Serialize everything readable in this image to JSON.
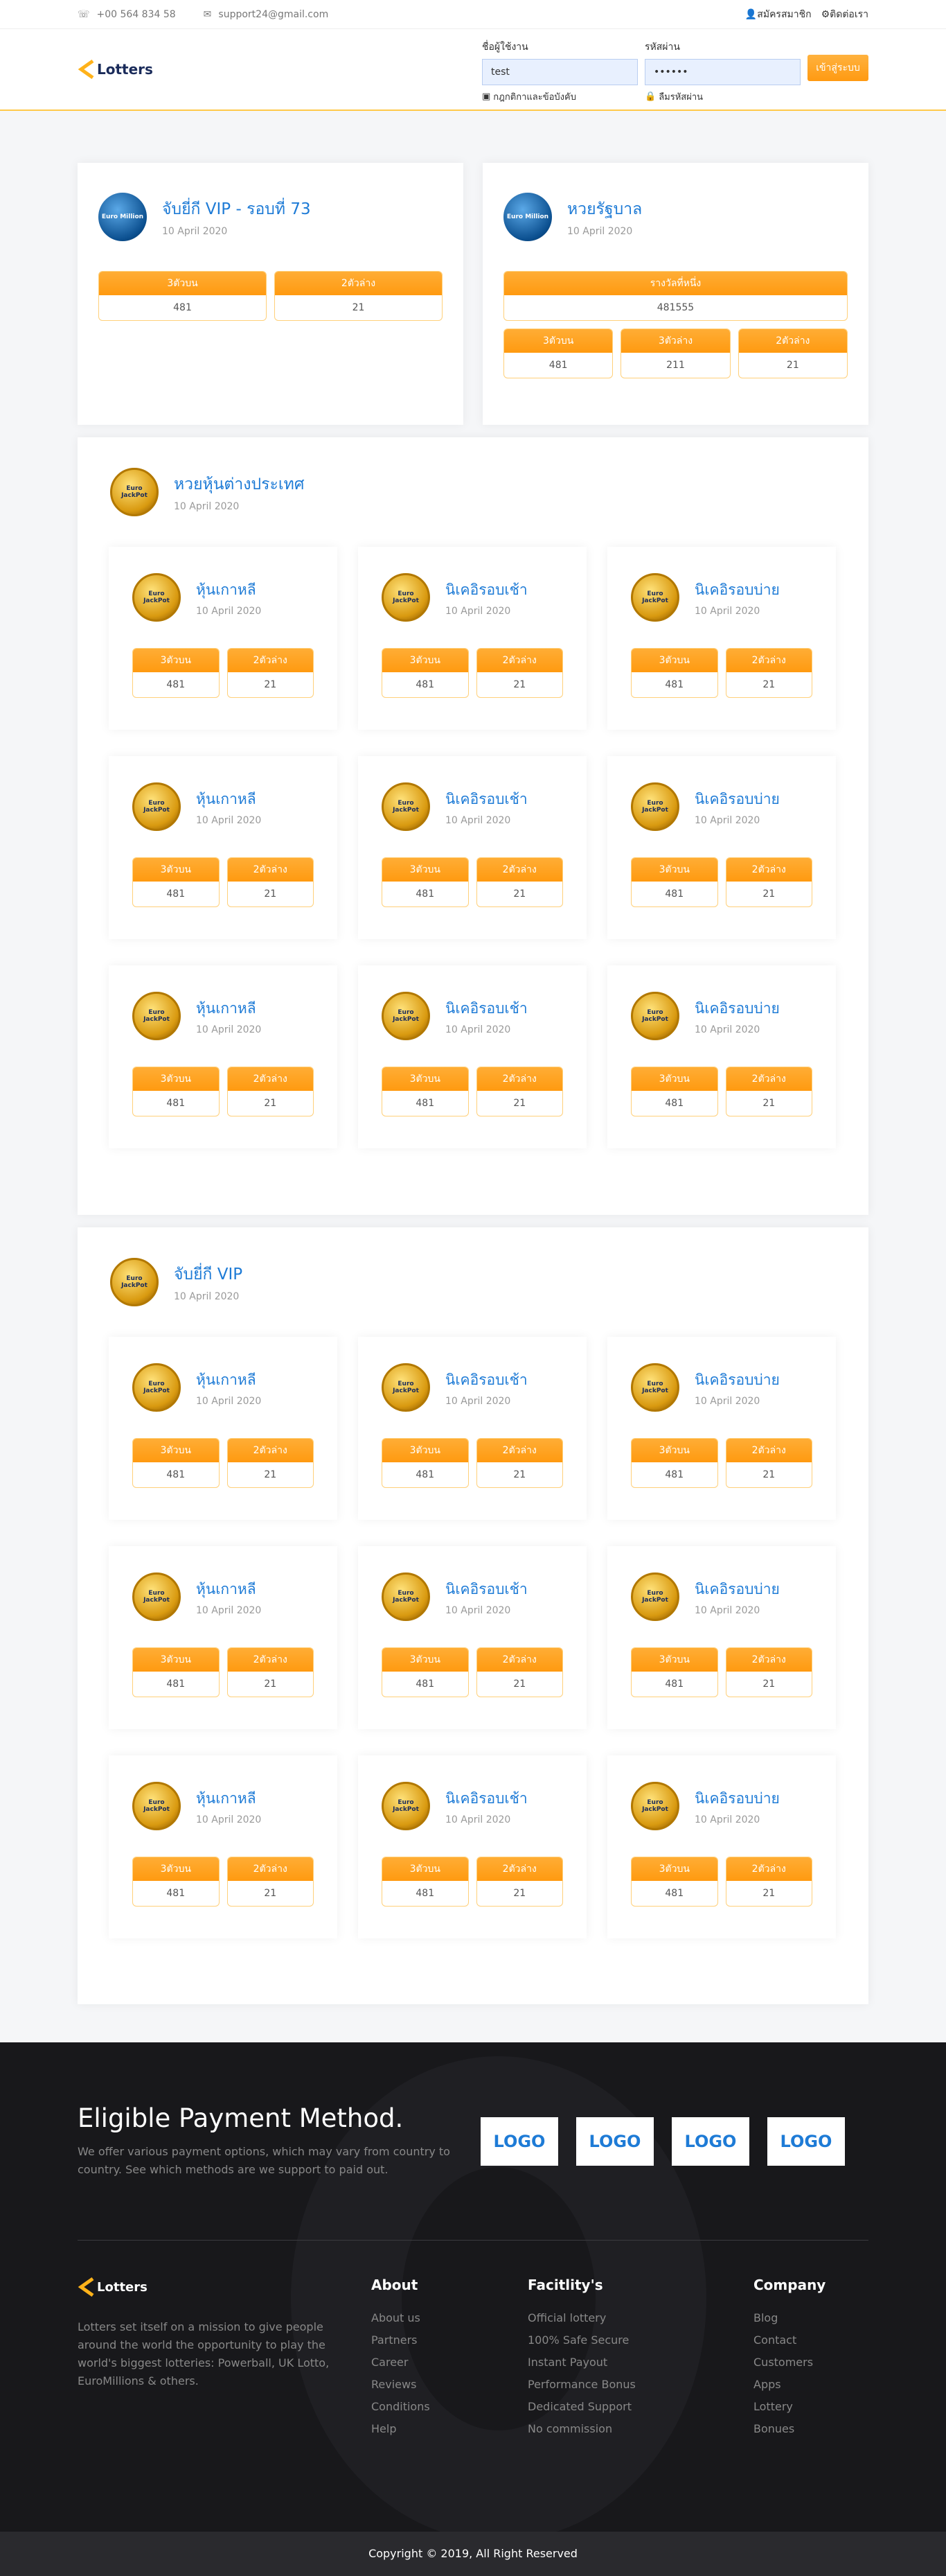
{
  "topbar": {
    "phone": "+00 564 834 58",
    "email": "support24@gmail.com",
    "register": "สมัครสมาชิก",
    "contact": "ติดต่อเรา"
  },
  "header": {
    "logo": "Lotters",
    "username_label": "ชื่อผู้ใช้งาน",
    "username_value": "test",
    "password_label": "รหัสผ่าน",
    "password_value": "••••••",
    "terms": "กฎกติกาและข้อบังคับ",
    "forgot": "ลืมรหัสผ่าน",
    "login_button": "เข้าสู่ระบบ"
  },
  "vip_card": {
    "coin": "Euro Million",
    "title": "จับยี่กี VIP - รอบที่ 73",
    "date": "10 April 2020",
    "results": [
      {
        "label": "3ตัวบน",
        "value": "481"
      },
      {
        "label": "2ตัวล่าง",
        "value": "21"
      }
    ]
  },
  "gov_card": {
    "coin": "Euro Million",
    "title": "หวยรัฐบาล",
    "date": "10 April 2020",
    "first_prize_label": "รางวัลที่หนึ่ง",
    "first_prize_value": "481555",
    "results": [
      {
        "label": "3ตัวบน",
        "value": "481"
      },
      {
        "label": "3ตัวล่าง",
        "value": "211"
      },
      {
        "label": "2ตัวล่าง",
        "value": "21"
      }
    ]
  },
  "sections": [
    {
      "coin": "Euro JackPot",
      "title": "หวยหุ้นต่างประเทศ",
      "date": "10 April 2020",
      "items": [
        {
          "title": "หุ้นเกาหลี",
          "date": "10 April 2020",
          "l1": "3ตัวบน",
          "v1": "481",
          "l2": "2ตัวล่าง",
          "v2": "21"
        },
        {
          "title": "นิเคอิรอบเช้า",
          "date": "10 April 2020",
          "l1": "3ตัวบน",
          "v1": "481",
          "l2": "2ตัวล่าง",
          "v2": "21"
        },
        {
          "title": "นิเคอิรอบบ่าย",
          "date": "10 April 2020",
          "l1": "3ตัวบน",
          "v1": "481",
          "l2": "2ตัวล่าง",
          "v2": "21"
        },
        {
          "title": "หุ้นเกาหลี",
          "date": "10 April 2020",
          "l1": "3ตัวบน",
          "v1": "481",
          "l2": "2ตัวล่าง",
          "v2": "21"
        },
        {
          "title": "นิเคอิรอบเช้า",
          "date": "10 April 2020",
          "l1": "3ตัวบน",
          "v1": "481",
          "l2": "2ตัวล่าง",
          "v2": "21"
        },
        {
          "title": "นิเคอิรอบบ่าย",
          "date": "10 April 2020",
          "l1": "3ตัวบน",
          "v1": "481",
          "l2": "2ตัวล่าง",
          "v2": "21"
        },
        {
          "title": "หุ้นเกาหลี",
          "date": "10 April 2020",
          "l1": "3ตัวบน",
          "v1": "481",
          "l2": "2ตัวล่าง",
          "v2": "21"
        },
        {
          "title": "นิเคอิรอบเช้า",
          "date": "10 April 2020",
          "l1": "3ตัวบน",
          "v1": "481",
          "l2": "2ตัวล่าง",
          "v2": "21"
        },
        {
          "title": "นิเคอิรอบบ่าย",
          "date": "10 April 2020",
          "l1": "3ตัวบน",
          "v1": "481",
          "l2": "2ตัวล่าง",
          "v2": "21"
        }
      ]
    },
    {
      "coin": "Euro JackPot",
      "title": "จับยี่กี VIP",
      "date": "10 April 2020",
      "items": [
        {
          "title": "หุ้นเกาหลี",
          "date": "10 April 2020",
          "l1": "3ตัวบน",
          "v1": "481",
          "l2": "2ตัวล่าง",
          "v2": "21"
        },
        {
          "title": "นิเคอิรอบเช้า",
          "date": "10 April 2020",
          "l1": "3ตัวบน",
          "v1": "481",
          "l2": "2ตัวล่าง",
          "v2": "21"
        },
        {
          "title": "นิเคอิรอบบ่าย",
          "date": "10 April 2020",
          "l1": "3ตัวบน",
          "v1": "481",
          "l2": "2ตัวล่าง",
          "v2": "21"
        },
        {
          "title": "หุ้นเกาหลี",
          "date": "10 April 2020",
          "l1": "3ตัวบน",
          "v1": "481",
          "l2": "2ตัวล่าง",
          "v2": "21"
        },
        {
          "title": "นิเคอิรอบเช้า",
          "date": "10 April 2020",
          "l1": "3ตัวบน",
          "v1": "481",
          "l2": "2ตัวล่าง",
          "v2": "21"
        },
        {
          "title": "นิเคอิรอบบ่าย",
          "date": "10 April 2020",
          "l1": "3ตัวบน",
          "v1": "481",
          "l2": "2ตัวล่าง",
          "v2": "21"
        },
        {
          "title": "หุ้นเกาหลี",
          "date": "10 April 2020",
          "l1": "3ตัวบน",
          "v1": "481",
          "l2": "2ตัวล่าง",
          "v2": "21"
        },
        {
          "title": "นิเคอิรอบเช้า",
          "date": "10 April 2020",
          "l1": "3ตัวบน",
          "v1": "481",
          "l2": "2ตัวล่าง",
          "v2": "21"
        },
        {
          "title": "นิเคอิรอบบ่าย",
          "date": "10 April 2020",
          "l1": "3ตัวบน",
          "v1": "481",
          "l2": "2ตัวล่าง",
          "v2": "21"
        }
      ]
    }
  ],
  "footer": {
    "pay_title": "Eligible Payment Method.",
    "pay_text": "We offer various payment options, which may vary from country to country. See which methods are we support to paid out.",
    "logos": [
      "LOGO",
      "LOGO",
      "LOGO",
      "LOGO"
    ],
    "logo": "Lotters",
    "about_text": "Lotters set itself on a mission to give people around the world the opportunity to play the world's biggest lotteries: Powerball, UK Lotto, EuroMillions & others.",
    "cols": [
      {
        "title": "About",
        "links": [
          "About us",
          "Partners",
          "Career",
          "Reviews",
          "Conditions",
          "Help"
        ]
      },
      {
        "title": "Facitlity's",
        "links": [
          "Official lottery",
          "100% Safe Secure",
          "Instant Payout",
          "Performance Bonus",
          "Dedicated Support",
          "No commission"
        ]
      },
      {
        "title": "Company",
        "links": [
          "Blog",
          "Contact",
          "Customers",
          "Apps",
          "Lottery",
          "Bonues"
        ]
      }
    ],
    "copyright": "Copyright © 2019, All Right Reserved"
  },
  "colors": {
    "accent": "#ff9a12",
    "title_blue": "#1e7bd6",
    "footer_bg": "#18181b"
  }
}
